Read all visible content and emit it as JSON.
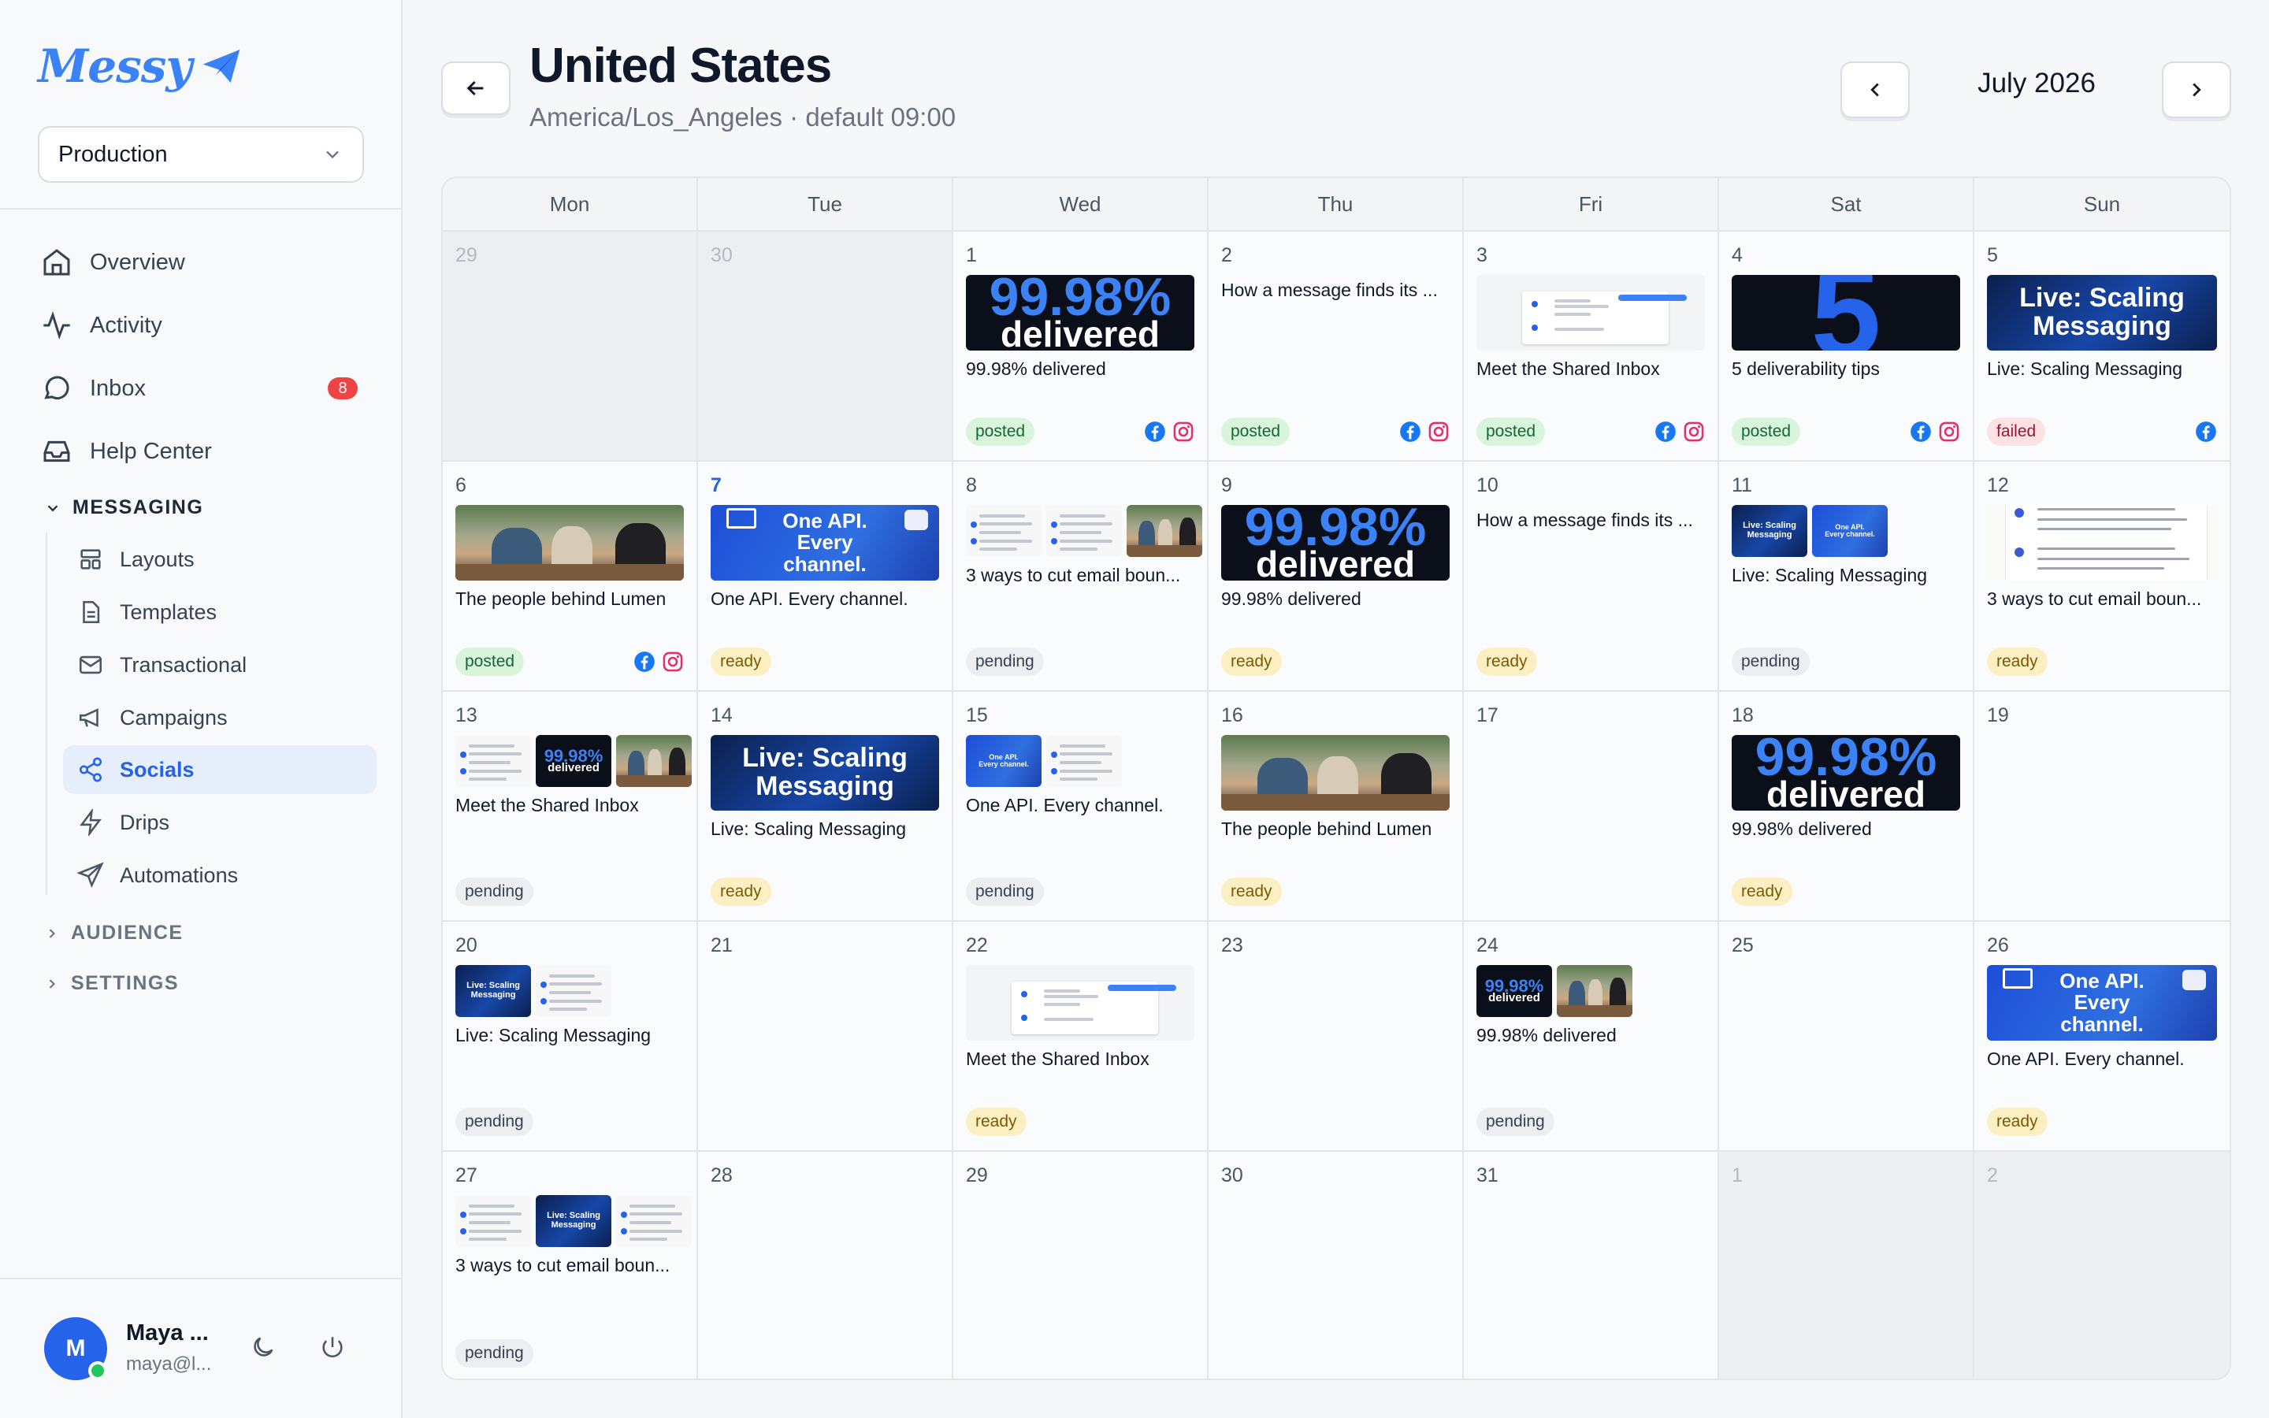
{
  "sidebar": {
    "logo_text": "Messy",
    "environment": "Production",
    "nav": [
      {
        "label": "Overview",
        "icon": "home-icon"
      },
      {
        "label": "Activity",
        "icon": "activity-icon"
      },
      {
        "label": "Inbox",
        "icon": "chat-icon",
        "badge": "8"
      },
      {
        "label": "Help Center",
        "icon": "inbox-tray-icon"
      }
    ],
    "messaging_section": "MESSAGING",
    "messaging_items": [
      {
        "label": "Layouts",
        "icon": "layout-icon"
      },
      {
        "label": "Templates",
        "icon": "file-icon"
      },
      {
        "label": "Transactional",
        "icon": "mail-icon"
      },
      {
        "label": "Campaigns",
        "icon": "megaphone-icon"
      },
      {
        "label": "Socials",
        "icon": "share-icon",
        "active": true
      },
      {
        "label": "Drips",
        "icon": "zap-icon"
      },
      {
        "label": "Automations",
        "icon": "send-icon"
      }
    ],
    "audience_section": "AUDIENCE",
    "settings_section": "SETTINGS",
    "user": {
      "initial": "M",
      "name": "Maya ...",
      "email": "maya@l..."
    }
  },
  "header": {
    "title": "United States",
    "subtitle": "America/Los_Angeles · default 09:00",
    "month": "July 2026"
  },
  "calendar": {
    "weekdays": [
      "Mon",
      "Tue",
      "Wed",
      "Thu",
      "Fri",
      "Sat",
      "Sun"
    ],
    "thumb_text": {
      "stat_big": "99.98%",
      "stat_small": "delivered",
      "five": "5",
      "live": "Live: Scaling Messaging",
      "api": "One API. Every channel."
    },
    "days": [
      {
        "day": "29",
        "out": true
      },
      {
        "day": "30",
        "out": true
      },
      {
        "day": "1",
        "thumbs": [
          "stat"
        ],
        "title": "99.98% delivered",
        "status": "posted",
        "socials": [
          "facebook",
          "instagram"
        ]
      },
      {
        "day": "2",
        "thumbs": [],
        "title": "How a message finds its ...",
        "status": "posted",
        "socials": [
          "facebook",
          "instagram"
        ]
      },
      {
        "day": "3",
        "thumbs": [
          "inbox"
        ],
        "title": "Meet the Shared Inbox",
        "status": "posted",
        "socials": [
          "facebook",
          "instagram"
        ]
      },
      {
        "day": "4",
        "thumbs": [
          "five"
        ],
        "title": "5 deliverability tips",
        "status": "posted",
        "socials": [
          "facebook",
          "instagram"
        ]
      },
      {
        "day": "5",
        "thumbs": [
          "live"
        ],
        "title": "Live: Scaling Messaging",
        "status": "failed",
        "socials": [
          "facebook"
        ]
      },
      {
        "day": "6",
        "thumbs": [
          "people"
        ],
        "title": "The people behind Lumen",
        "status": "posted",
        "socials": [
          "facebook",
          "instagram"
        ]
      },
      {
        "day": "7",
        "today": true,
        "thumbs": [
          "api"
        ],
        "title": "One API. Every channel.",
        "status": "ready"
      },
      {
        "day": "8",
        "thumbs": [
          "doc",
          "doc",
          "people"
        ],
        "small": true,
        "title": "3 ways to cut email boun...",
        "status": "pending"
      },
      {
        "day": "9",
        "thumbs": [
          "stat"
        ],
        "title": "99.98% delivered",
        "status": "ready"
      },
      {
        "day": "10",
        "thumbs": [],
        "title": "How a message finds its ...",
        "status": "ready"
      },
      {
        "day": "11",
        "thumbs": [
          "live",
          "api"
        ],
        "small": true,
        "title": "Live: Scaling Messaging",
        "status": "pending"
      },
      {
        "day": "12",
        "thumbs": [
          "tips"
        ],
        "title": "3 ways to cut email boun...",
        "status": "ready"
      },
      {
        "day": "13",
        "thumbs": [
          "doc",
          "stat",
          "people"
        ],
        "small": true,
        "title": "Meet the Shared Inbox",
        "status": "pending"
      },
      {
        "day": "14",
        "thumbs": [
          "live"
        ],
        "title": "Live: Scaling Messaging",
        "status": "ready"
      },
      {
        "day": "15",
        "thumbs": [
          "api",
          "doc"
        ],
        "small": true,
        "title": "One API. Every channel.",
        "status": "pending"
      },
      {
        "day": "16",
        "thumbs": [
          "people"
        ],
        "title": "The people behind Lumen",
        "status": "ready"
      },
      {
        "day": "17"
      },
      {
        "day": "18",
        "thumbs": [
          "stat"
        ],
        "title": "99.98% delivered",
        "status": "ready"
      },
      {
        "day": "19"
      },
      {
        "day": "20",
        "thumbs": [
          "live",
          "doc"
        ],
        "small": true,
        "title": "Live: Scaling Messaging",
        "status": "pending"
      },
      {
        "day": "21"
      },
      {
        "day": "22",
        "thumbs": [
          "inbox"
        ],
        "title": "Meet the Shared Inbox",
        "status": "ready"
      },
      {
        "day": "23"
      },
      {
        "day": "24",
        "thumbs": [
          "stat",
          "people"
        ],
        "small": true,
        "title": "99.98% delivered",
        "status": "pending"
      },
      {
        "day": "25"
      },
      {
        "day": "26",
        "thumbs": [
          "api"
        ],
        "title": "One API. Every channel.",
        "status": "ready"
      },
      {
        "day": "27",
        "thumbs": [
          "doc",
          "live",
          "doc"
        ],
        "small": true,
        "title": "3 ways to cut email boun...",
        "status": "pending"
      },
      {
        "day": "28"
      },
      {
        "day": "29"
      },
      {
        "day": "30"
      },
      {
        "day": "31"
      },
      {
        "day": "1",
        "out": true
      },
      {
        "day": "2",
        "out": true
      }
    ]
  },
  "colors": {
    "accent": "#2563eb",
    "facebook": "#1877f2",
    "instagram": "#e1306c"
  }
}
